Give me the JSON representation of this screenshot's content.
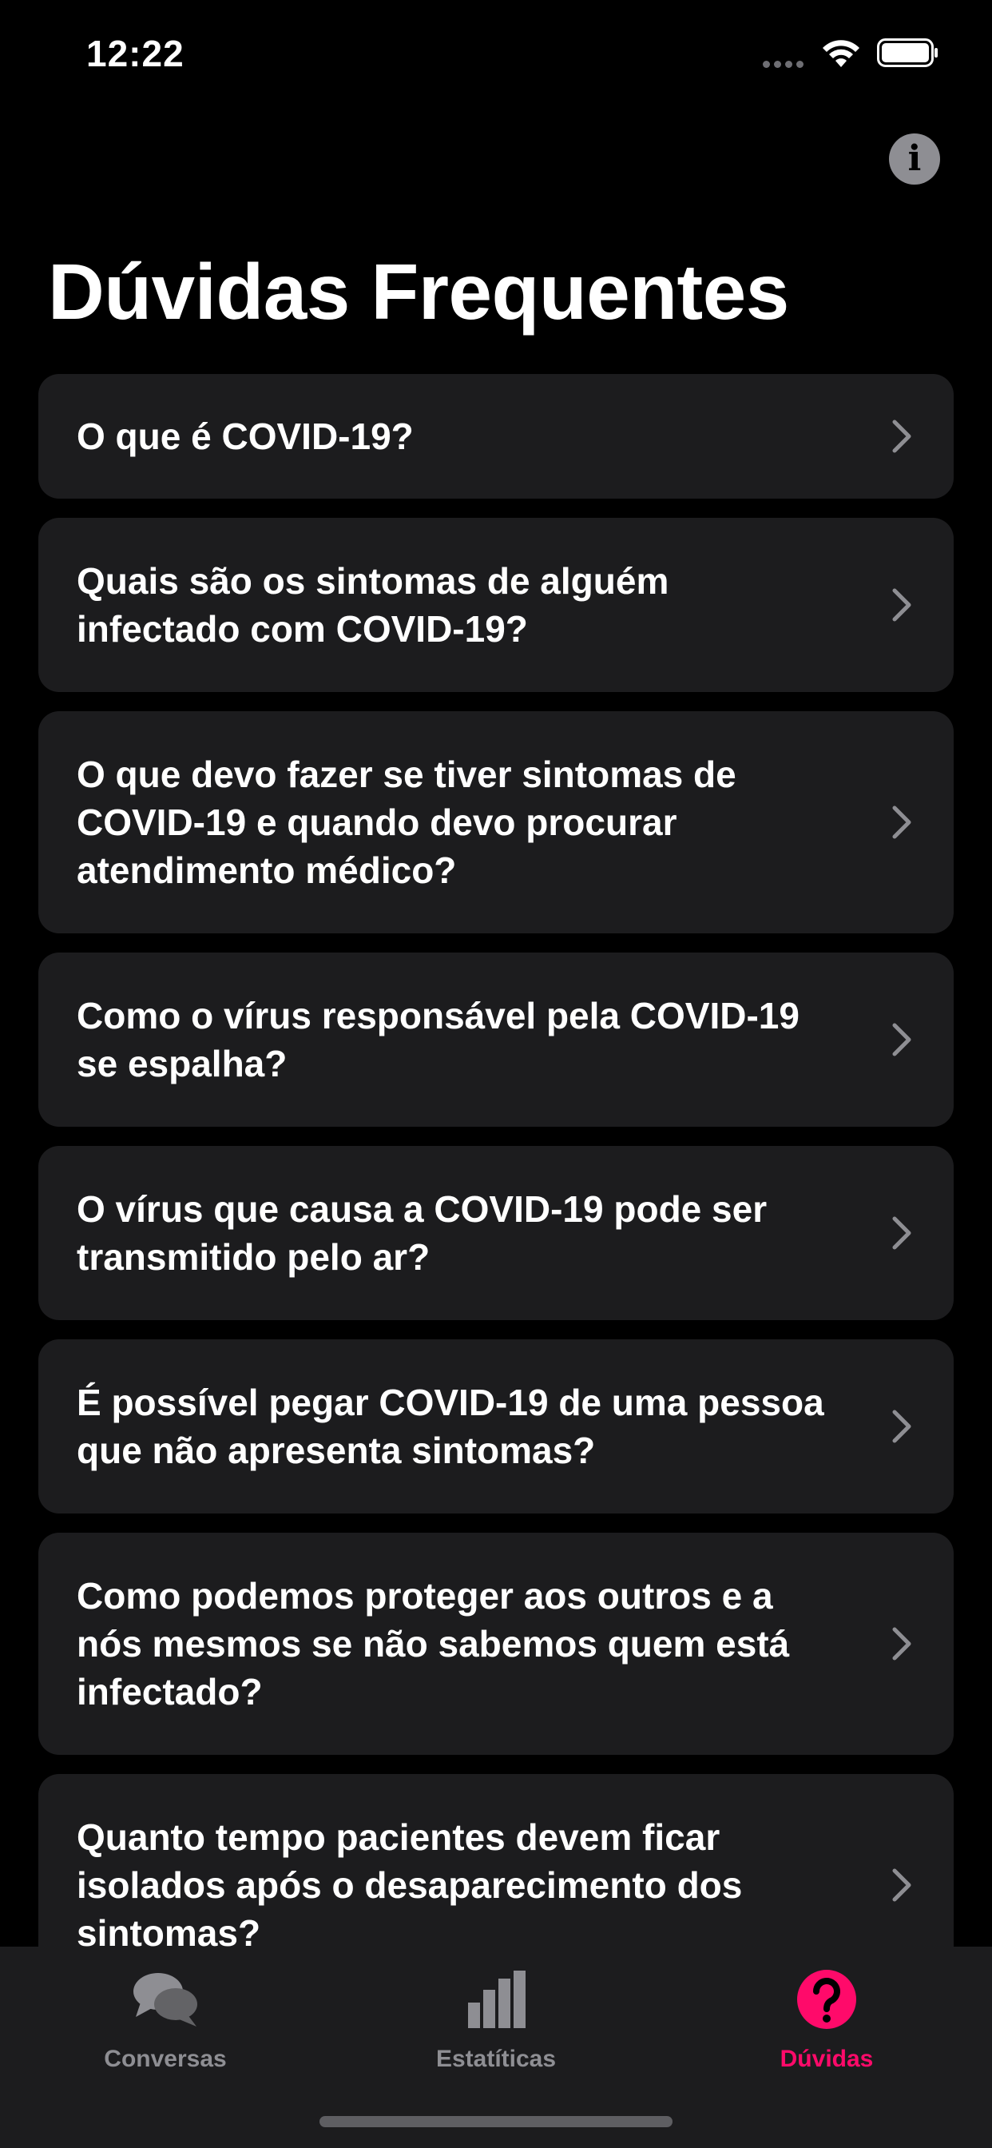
{
  "status_bar": {
    "time": "12:22"
  },
  "header": {
    "title": "Dúvidas Frequentes",
    "info_icon": "info-icon"
  },
  "faq": [
    {
      "question": "O que é COVID-19?"
    },
    {
      "question": "Quais são os sintomas de alguém infectado com COVID-19?"
    },
    {
      "question": "O que devo fazer se tiver sintomas de COVID-19 e quando devo procurar atendimento médico?"
    },
    {
      "question": "Como o vírus responsável pela COVID-19 se espalha?"
    },
    {
      "question": "O vírus que causa a COVID-19 pode ser transmitido pelo ar?"
    },
    {
      "question": "É possível pegar COVID-19 de uma pessoa que não apresenta sintomas?"
    },
    {
      "question": "Como podemos proteger aos outros e a nós mesmos se não sabemos quem está infectado?"
    },
    {
      "question": "Quanto tempo pacientes devem ficar isolados após o desaparecimento dos sintomas?"
    }
  ],
  "tab_bar": {
    "tabs": [
      {
        "label": "Conversas",
        "icon": "chat-bubbles-icon",
        "active": false
      },
      {
        "label": "Estatíticas",
        "icon": "bar-chart-icon",
        "active": false
      },
      {
        "label": "Dúvidas",
        "icon": "question-mark-icon",
        "active": true
      }
    ]
  },
  "colors": {
    "accent": "#ff0a6a",
    "card": "#1c1c1e",
    "background": "#000000",
    "inactive": "#8e8e93"
  }
}
